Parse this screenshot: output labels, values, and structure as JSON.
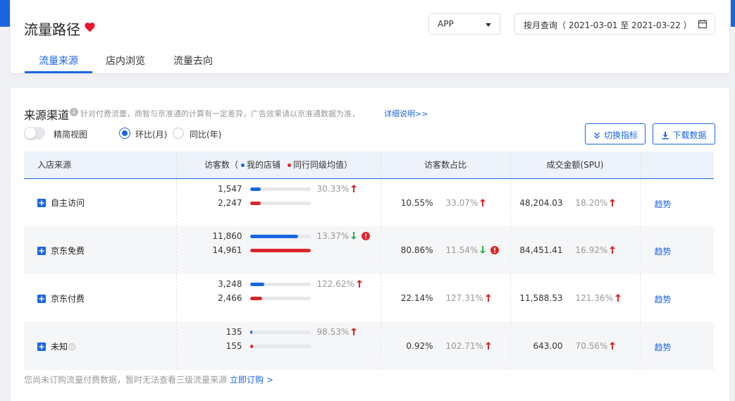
{
  "header": {
    "title": "流量路径",
    "app_select": "APP",
    "date_range": "按月查询（ 2021-03-01 至 2021-03-22 ）",
    "tabs": [
      {
        "label": "流量来源",
        "active": true
      },
      {
        "label": "店内浏览",
        "active": false
      },
      {
        "label": "流量去向",
        "active": false
      }
    ]
  },
  "section": {
    "title": "来源渠道",
    "note": "针对付费流量，商智与京准通的计算有一定差异，广告效果请以京准通数据为准，",
    "link": "详细说明>>",
    "toggle_label": "精简视图",
    "radio_mom": "环比(月)",
    "radio_yoy": "同比(年)",
    "btn_switch": "切换指标",
    "btn_download": "下载数据"
  },
  "table": {
    "headers": {
      "source": "入店来源",
      "visitors_prefix": "访客数（",
      "my_store": "我的店铺",
      "peer_avg": "同行同级均值",
      "visitors_suffix": "）",
      "share": "访客数占比",
      "gmv": "成交金额(SPU)"
    },
    "rows": [
      {
        "name": "自主访问",
        "help": false,
        "mine": "1,547",
        "peer": "2,247",
        "mine_ratio": 0.18,
        "peer_ratio": 0.18,
        "visit_change": "30.33%",
        "visit_dir": "up",
        "visit_warn": false,
        "share": "10.55%",
        "share_change": "33.07%",
        "share_dir": "up",
        "share_warn": false,
        "gmv": "48,204.03",
        "gmv_change": "18.20%",
        "gmv_dir": "up",
        "trend": "趋势"
      },
      {
        "name": "京东免费",
        "help": false,
        "mine": "11,860",
        "peer": "14,961",
        "mine_ratio": 0.8,
        "peer_ratio": 1.0,
        "visit_change": "13.37%",
        "visit_dir": "down",
        "visit_warn": true,
        "share": "80.86%",
        "share_change": "11.54%",
        "share_dir": "down",
        "share_warn": true,
        "gmv": "84,451.41",
        "gmv_change": "16.92%",
        "gmv_dir": "up",
        "trend": "趋势"
      },
      {
        "name": "京东付费",
        "help": false,
        "mine": "3,248",
        "peer": "2,466",
        "mine_ratio": 0.24,
        "peer_ratio": 0.2,
        "visit_change": "122.62%",
        "visit_dir": "up",
        "visit_warn": false,
        "share": "22.14%",
        "share_change": "127.31%",
        "share_dir": "up",
        "share_warn": false,
        "gmv": "11,588.53",
        "gmv_change": "121.36%",
        "gmv_dir": "up",
        "trend": "趋势"
      },
      {
        "name": "未知",
        "help": true,
        "mine": "135",
        "peer": "155",
        "mine_ratio": 0.04,
        "peer_ratio": 0.05,
        "visit_change": "98.53%",
        "visit_dir": "up",
        "visit_warn": false,
        "share": "0.92%",
        "share_change": "102.71%",
        "share_dir": "up",
        "share_warn": false,
        "gmv": "643.00",
        "gmv_change": "70.56%",
        "gmv_dir": "up",
        "trend": "趋势"
      }
    ]
  },
  "footer": {
    "note": "您尚未订购流量付费数据，暂时无法查看三级流量来源",
    "link": "立即订购 >"
  },
  "colors": {
    "accent": "#1a66e0",
    "mine_bar": "#1a66e0",
    "peer_bar": "#d9262a",
    "up_arrow": "#d9262a",
    "down_arrow": "#2bb24c"
  }
}
